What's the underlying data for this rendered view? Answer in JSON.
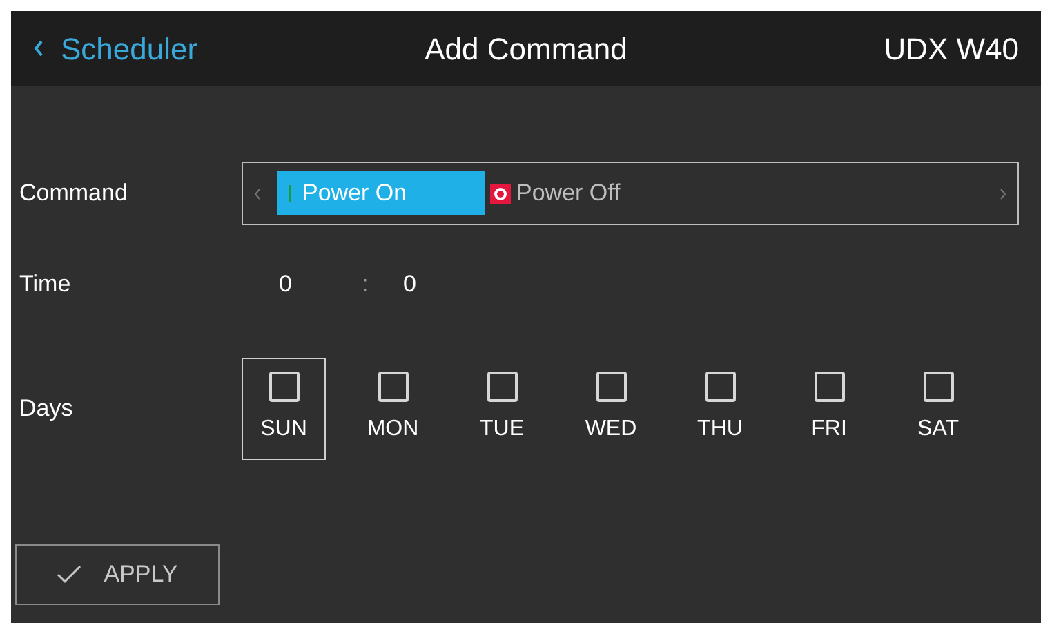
{
  "header": {
    "back": "Scheduler",
    "title": "Add Command",
    "device": "UDX W40"
  },
  "command": {
    "label": "Command",
    "options": [
      {
        "label": "Power On",
        "kind": "on",
        "selected": true
      },
      {
        "label": "Power Off",
        "kind": "off",
        "selected": false
      }
    ]
  },
  "time": {
    "label": "Time",
    "hours": "0",
    "separator": ":",
    "minutes": "0"
  },
  "days": {
    "label": "Days",
    "items": [
      {
        "label": "SUN",
        "checked": false,
        "focused": true
      },
      {
        "label": "MON",
        "checked": false,
        "focused": false
      },
      {
        "label": "TUE",
        "checked": false,
        "focused": false
      },
      {
        "label": "WED",
        "checked": false,
        "focused": false
      },
      {
        "label": "THU",
        "checked": false,
        "focused": false
      },
      {
        "label": "FRI",
        "checked": false,
        "focused": false
      },
      {
        "label": "SAT",
        "checked": false,
        "focused": false
      }
    ]
  },
  "apply": {
    "label": "APPLY"
  }
}
